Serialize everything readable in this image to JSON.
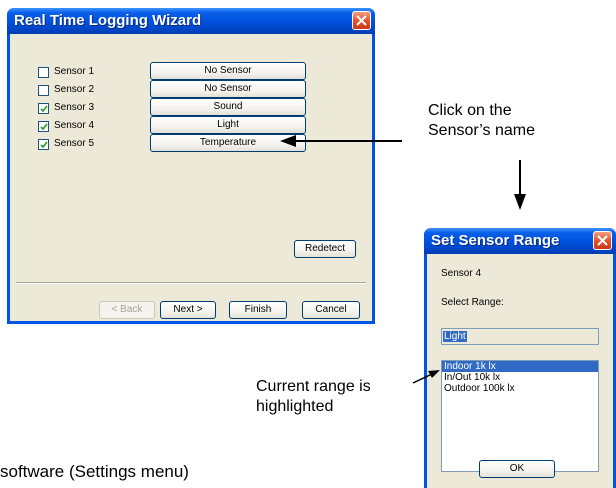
{
  "wizard": {
    "title": "Real Time Logging Wizard",
    "sensors": [
      {
        "label": "Sensor 1",
        "checked": false,
        "button": "No Sensor"
      },
      {
        "label": "Sensor 2",
        "checked": false,
        "button": "No Sensor"
      },
      {
        "label": "Sensor 3",
        "checked": true,
        "button": "Sound"
      },
      {
        "label": "Sensor 4",
        "checked": true,
        "button": "Light"
      },
      {
        "label": "Sensor 5",
        "checked": true,
        "button": "Temperature"
      }
    ],
    "redetect": "Redetect",
    "back": "< Back",
    "next": "Next >",
    "finish": "Finish",
    "cancel": "Cancel"
  },
  "range_dialog": {
    "title": "Set Sensor Range",
    "sensor_label": "Sensor 4",
    "select_label": "Select Range:",
    "field_value": "Light",
    "options": [
      "Indoor 1k  lx",
      "In/Out 10k  lx",
      "Outdoor 100k lx"
    ],
    "selected_index": 0,
    "ok": "OK"
  },
  "annotations": {
    "click_note_line1": "Click on the",
    "click_note_line2": "Sensor’s name",
    "range_note_line1": "Current range is",
    "range_note_line2": "highlighted"
  },
  "caption": "software (Settings menu)"
}
